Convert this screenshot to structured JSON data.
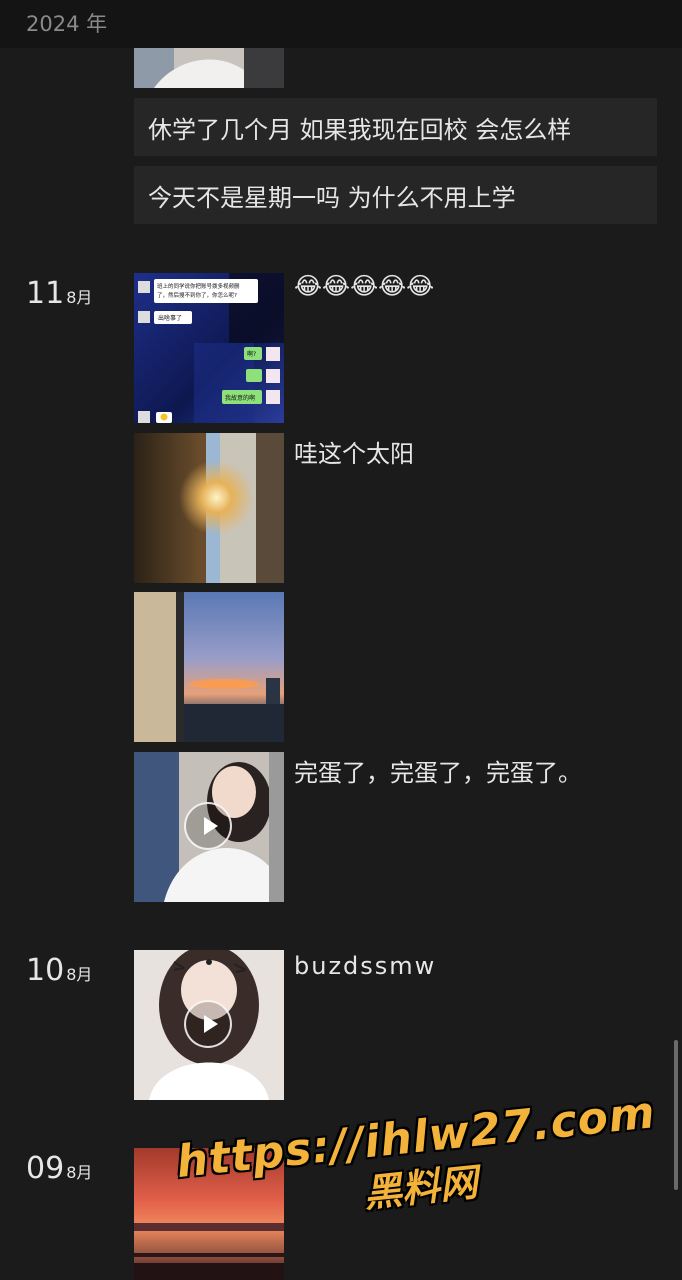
{
  "header": {
    "year": "2024 年"
  },
  "entries_top": [
    {
      "text": "休学了几个月 如果我现在回校 会怎么样"
    },
    {
      "text": "今天不是星期一吗 为什么不用上学"
    }
  ],
  "days": [
    {
      "day": "11",
      "month": "8月",
      "posts": [
        {
          "caption": "😂😂😂😂😂",
          "kind": "chat-screenshot",
          "chat": {
            "line1": "班上的同学说你把账号拨多视频删了，然后搜不到你了，你怎么呢？",
            "line2": "出啥事了",
            "line3": "啊?",
            "line4": "我故意的啊"
          }
        },
        {
          "caption": "哇这个太阳",
          "kind": "photo-sun-curtain"
        },
        {
          "caption": "",
          "kind": "photo-sunset-window"
        },
        {
          "caption": "完蛋了，完蛋了，完蛋了。",
          "kind": "video"
        }
      ]
    },
    {
      "day": "10",
      "month": "8月",
      "posts": [
        {
          "caption": "buzdssmw",
          "kind": "video"
        }
      ]
    },
    {
      "day": "09",
      "month": "8月",
      "posts": [
        {
          "caption": "",
          "kind": "photo-red-sunset"
        }
      ]
    }
  ],
  "watermark": {
    "url": "https://ihlw27.com",
    "name": "黑料网"
  }
}
